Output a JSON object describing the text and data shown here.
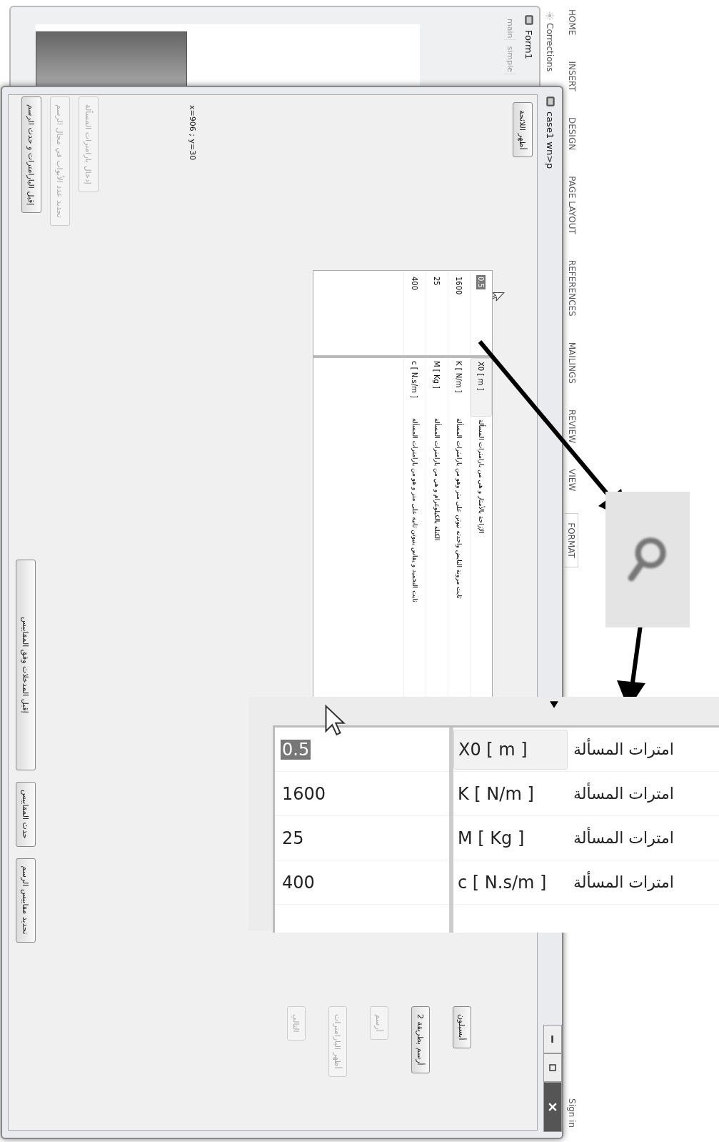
{
  "ribbon": {
    "tabs": [
      {
        "label": "HOME",
        "selected": false
      },
      {
        "label": "INSERT",
        "selected": false
      },
      {
        "label": "DESIGN",
        "selected": false
      },
      {
        "label": "PAGE LAYOUT",
        "selected": false
      },
      {
        "label": "REFERENCES",
        "selected": false
      },
      {
        "label": "MAILINGS",
        "selected": false
      },
      {
        "label": "REVIEW",
        "selected": false
      },
      {
        "label": "VIEW",
        "selected": false
      },
      {
        "label": "FORMAT",
        "selected": true
      }
    ],
    "sign_in": "Sign in",
    "corrections": "Corrections"
  },
  "background_window": {
    "title": "Form1",
    "tabs": [
      "main",
      "simple"
    ]
  },
  "window": {
    "title": "case1 wn>p"
  },
  "show_list_button": "أظهر اللائحة",
  "table": {
    "rows": [
      {
        "value": "0.5",
        "selected": true,
        "unit": "X0 [ m ]",
        "description": "الإزاحة بالأمتار و هي من بارامترات المسألة"
      },
      {
        "value": "1600",
        "selected": false,
        "unit": "K [ N/m ]",
        "description": "ثابت مرونة النابض واحدته نيوتن على متر وهو من بارامترات المسألة"
      },
      {
        "value": "25",
        "selected": false,
        "unit": "M [ Kg ]",
        "description": "الكتلة بالكيلوغرام و هي من بارامترات المسألة"
      },
      {
        "value": "400",
        "selected": false,
        "unit": "c [ N.s/m ]",
        "description": "ثابت التخميد و يقاس بنيوتن ثانية على متر و هو من بارامترات المسألة"
      }
    ]
  },
  "coordinates": "x=906 ; y=30",
  "left_buttons": [
    {
      "label": "إدخال بارامترات المسألة",
      "disabled": true
    },
    {
      "label": "تحديد عدد الأبواب في مجال الرسم",
      "disabled": true
    },
    {
      "label": "إقبل البارامترات و حدث الرسم",
      "disabled": false
    }
  ],
  "bottom_buttons": [
    {
      "label": "إقبل المدخلات وفق المقاييس",
      "disabled": false
    },
    {
      "label": "حدث المقاييس",
      "disabled": false
    },
    {
      "label": "تحديد مقاييس الرسم",
      "disabled": false
    }
  ],
  "side_buttons": [
    {
      "label": "أبسيلون",
      "disabled": false
    },
    {
      "label": "أرسم بطريقة 2",
      "disabled": false
    },
    {
      "label": "أرسم",
      "disabled": true
    },
    {
      "label": "أظهر البارامترات",
      "disabled": true
    },
    {
      "label": "التالي",
      "disabled": true
    }
  ],
  "callout": {
    "rows": [
      {
        "value": "0.5",
        "selected": true,
        "unit": "X0 [ m ]",
        "description": "امترات المسألة"
      },
      {
        "value": "1600",
        "selected": false,
        "unit": "K [ N/m ]",
        "description": "امترات المسألة"
      },
      {
        "value": "25",
        "selected": false,
        "unit": "M [ Kg ]",
        "description": "امترات المسألة"
      },
      {
        "value": "400",
        "selected": false,
        "unit": "c [ N.s/m ]",
        "description": "امترات المسألة"
      }
    ]
  }
}
